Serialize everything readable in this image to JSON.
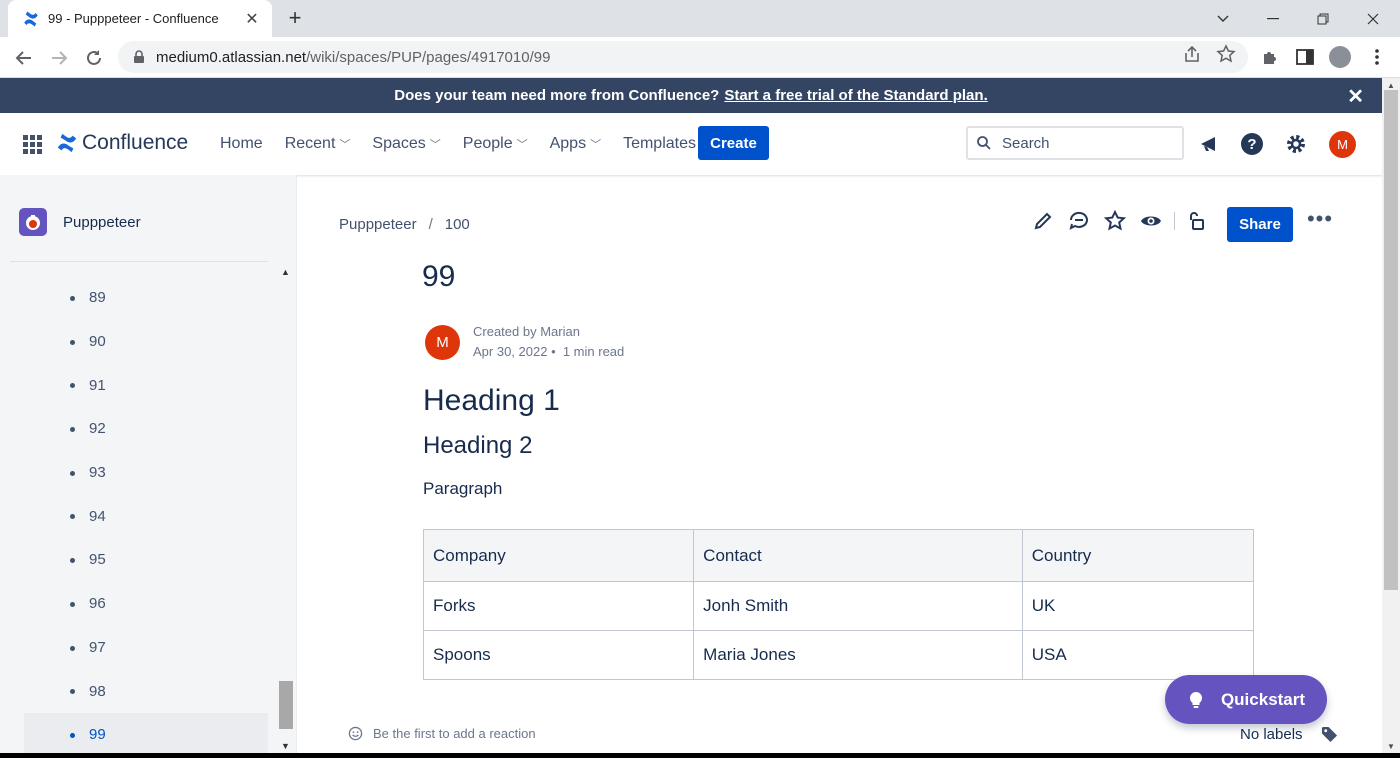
{
  "browser": {
    "tab_title": "99 - Pupppeteer - Confluence",
    "url_host": "medium0.atlassian.net",
    "url_path": "/wiki/spaces/PUP/pages/4917010/99"
  },
  "banner": {
    "text": "Does your team need more from Confluence?",
    "link": "Start a free trial of the Standard plan."
  },
  "nav": {
    "product": "Confluence",
    "links": [
      "Home",
      "Recent",
      "Spaces",
      "People",
      "Apps",
      "Templates"
    ],
    "create_label": "Create",
    "search_placeholder": "Search",
    "avatar_initial": "M"
  },
  "sidebar": {
    "space_name": "Pupppeteer",
    "pages": [
      "89",
      "90",
      "91",
      "92",
      "93",
      "94",
      "95",
      "96",
      "97",
      "98",
      "99"
    ],
    "active_page": "99"
  },
  "page": {
    "breadcrumb": [
      "Pupppeteer",
      "100"
    ],
    "share_label": "Share",
    "title": "99",
    "author_initial": "M",
    "created_by": "Created by Marian",
    "date": "Apr 30, 2022",
    "read_time": "1 min read",
    "heading1": "Heading 1",
    "heading2": "Heading 2",
    "paragraph": "Paragraph",
    "table": {
      "headers": [
        "Company",
        "Contact",
        "Country"
      ],
      "rows": [
        [
          "Forks",
          "Jonh Smith",
          "UK"
        ],
        [
          "Spoons",
          "Maria Jones",
          "USA"
        ]
      ]
    },
    "reaction_text": "Be the first to add a reaction",
    "labels_text": "No labels",
    "quickstart_label": "Quickstart"
  },
  "colors": {
    "brand_blue": "#0052cc",
    "banner_bg": "#344563",
    "quickstart_purple": "#6554c0",
    "avatar_red": "#de350b"
  }
}
